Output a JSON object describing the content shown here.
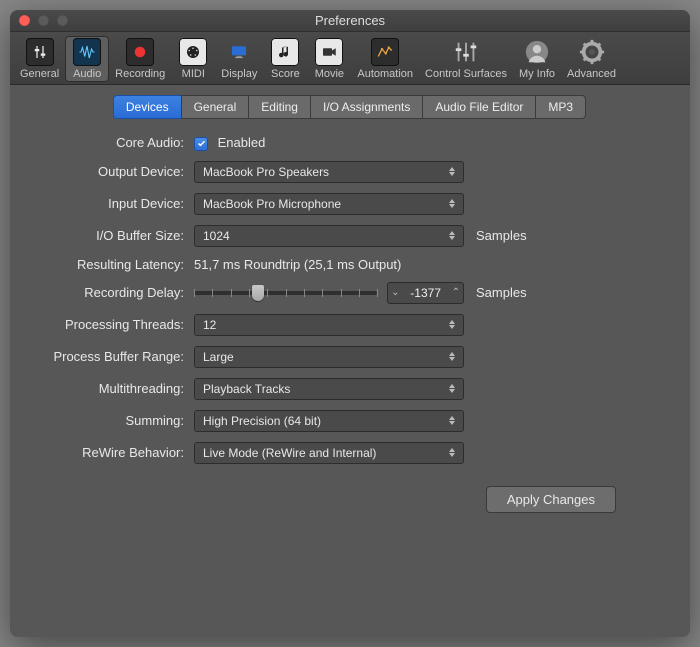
{
  "window": {
    "title": "Preferences"
  },
  "toolbar": {
    "items": [
      {
        "label": "General"
      },
      {
        "label": "Audio",
        "selected": true
      },
      {
        "label": "Recording"
      },
      {
        "label": "MIDI"
      },
      {
        "label": "Display"
      },
      {
        "label": "Score"
      },
      {
        "label": "Movie"
      },
      {
        "label": "Automation"
      },
      {
        "label": "Control Surfaces"
      },
      {
        "label": "My Info"
      },
      {
        "label": "Advanced"
      }
    ]
  },
  "subtabs": [
    "Devices",
    "General",
    "Editing",
    "I/O Assignments",
    "Audio File Editor",
    "MP3"
  ],
  "active_subtab": "Devices",
  "form": {
    "core_audio": {
      "label": "Core Audio:",
      "value": "Enabled"
    },
    "output_device": {
      "label": "Output Device:",
      "value": "MacBook Pro Speakers"
    },
    "input_device": {
      "label": "Input Device:",
      "value": "MacBook Pro Microphone"
    },
    "io_buffer": {
      "label": "I/O Buffer Size:",
      "value": "1024",
      "unit": "Samples"
    },
    "latency": {
      "label": "Resulting Latency:",
      "value": "51,7 ms Roundtrip (25,1 ms Output)"
    },
    "recording_delay": {
      "label": "Recording Delay:",
      "value": "-1377",
      "unit": "Samples"
    },
    "processing_threads": {
      "label": "Processing Threads:",
      "value": "12"
    },
    "process_buffer_range": {
      "label": "Process Buffer Range:",
      "value": "Large"
    },
    "multithreading": {
      "label": "Multithreading:",
      "value": "Playback Tracks"
    },
    "summing": {
      "label": "Summing:",
      "value": "High Precision (64 bit)"
    },
    "rewire": {
      "label": "ReWire Behavior:",
      "value": "Live Mode (ReWire and Internal)"
    }
  },
  "apply_button": "Apply Changes"
}
